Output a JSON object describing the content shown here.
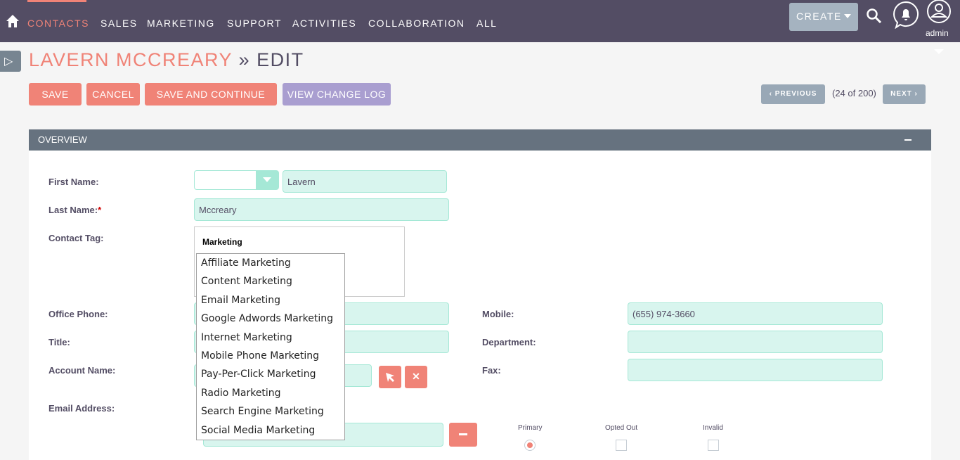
{
  "nav": {
    "items": [
      "CONTACTS",
      "SALES",
      "MARKETING",
      "SUPPORT",
      "ACTIVITIES",
      "COLLABORATION",
      "ALL"
    ],
    "create": "CREATE",
    "user": "admin"
  },
  "header": {
    "record": "LAVERN MCCREARY",
    "sep": " » ",
    "mode": "EDIT"
  },
  "actions": {
    "save": "SAVE",
    "cancel": "CANCEL",
    "save_continue": "SAVE AND CONTINUE",
    "change_log": "VIEW CHANGE LOG"
  },
  "pager": {
    "previous": "PREVIOUS",
    "next": "NEXT",
    "count": "(24 of 200)"
  },
  "panel": {
    "title": "OVERVIEW"
  },
  "fields": {
    "first_name": {
      "label": "First Name:",
      "salutation": "",
      "value": "Lavern"
    },
    "last_name": {
      "label": "Last Name:",
      "required": "*",
      "value": "Mccreary"
    },
    "contact_tag": {
      "label": "Contact Tag:",
      "group": "Marketing",
      "options": [
        "Affiliate Marketing",
        "Content Marketing",
        "Email Marketing",
        "Google Adwords Marketing",
        "Internet Marketing",
        "Mobile Phone Marketing",
        "Pay-Per-Click Marketing",
        "Radio Marketing",
        "Search Engine Marketing",
        "Social Media Marketing"
      ]
    },
    "office_phone": {
      "label": "Office Phone:",
      "value": ""
    },
    "mobile": {
      "label": "Mobile:",
      "value": "(655) 974-3660"
    },
    "title": {
      "label": "Title:",
      "value": ""
    },
    "department": {
      "label": "Department:",
      "value": ""
    },
    "account_name": {
      "label": "Account Name:",
      "value": ""
    },
    "fax": {
      "label": "Fax:",
      "value": ""
    },
    "email": {
      "label": "Email Address:",
      "value": "",
      "primary": "Primary",
      "opted_out": "Opted Out",
      "invalid": "Invalid",
      "primary_checked": true,
      "opted_out_checked": false,
      "invalid_checked": false
    }
  },
  "colors": {
    "nav": "#534d64",
    "accent": "#f08377",
    "input_bg": "#d8f5ee",
    "panel_header": "#66727f",
    "purple_button": "#a99ed0"
  }
}
